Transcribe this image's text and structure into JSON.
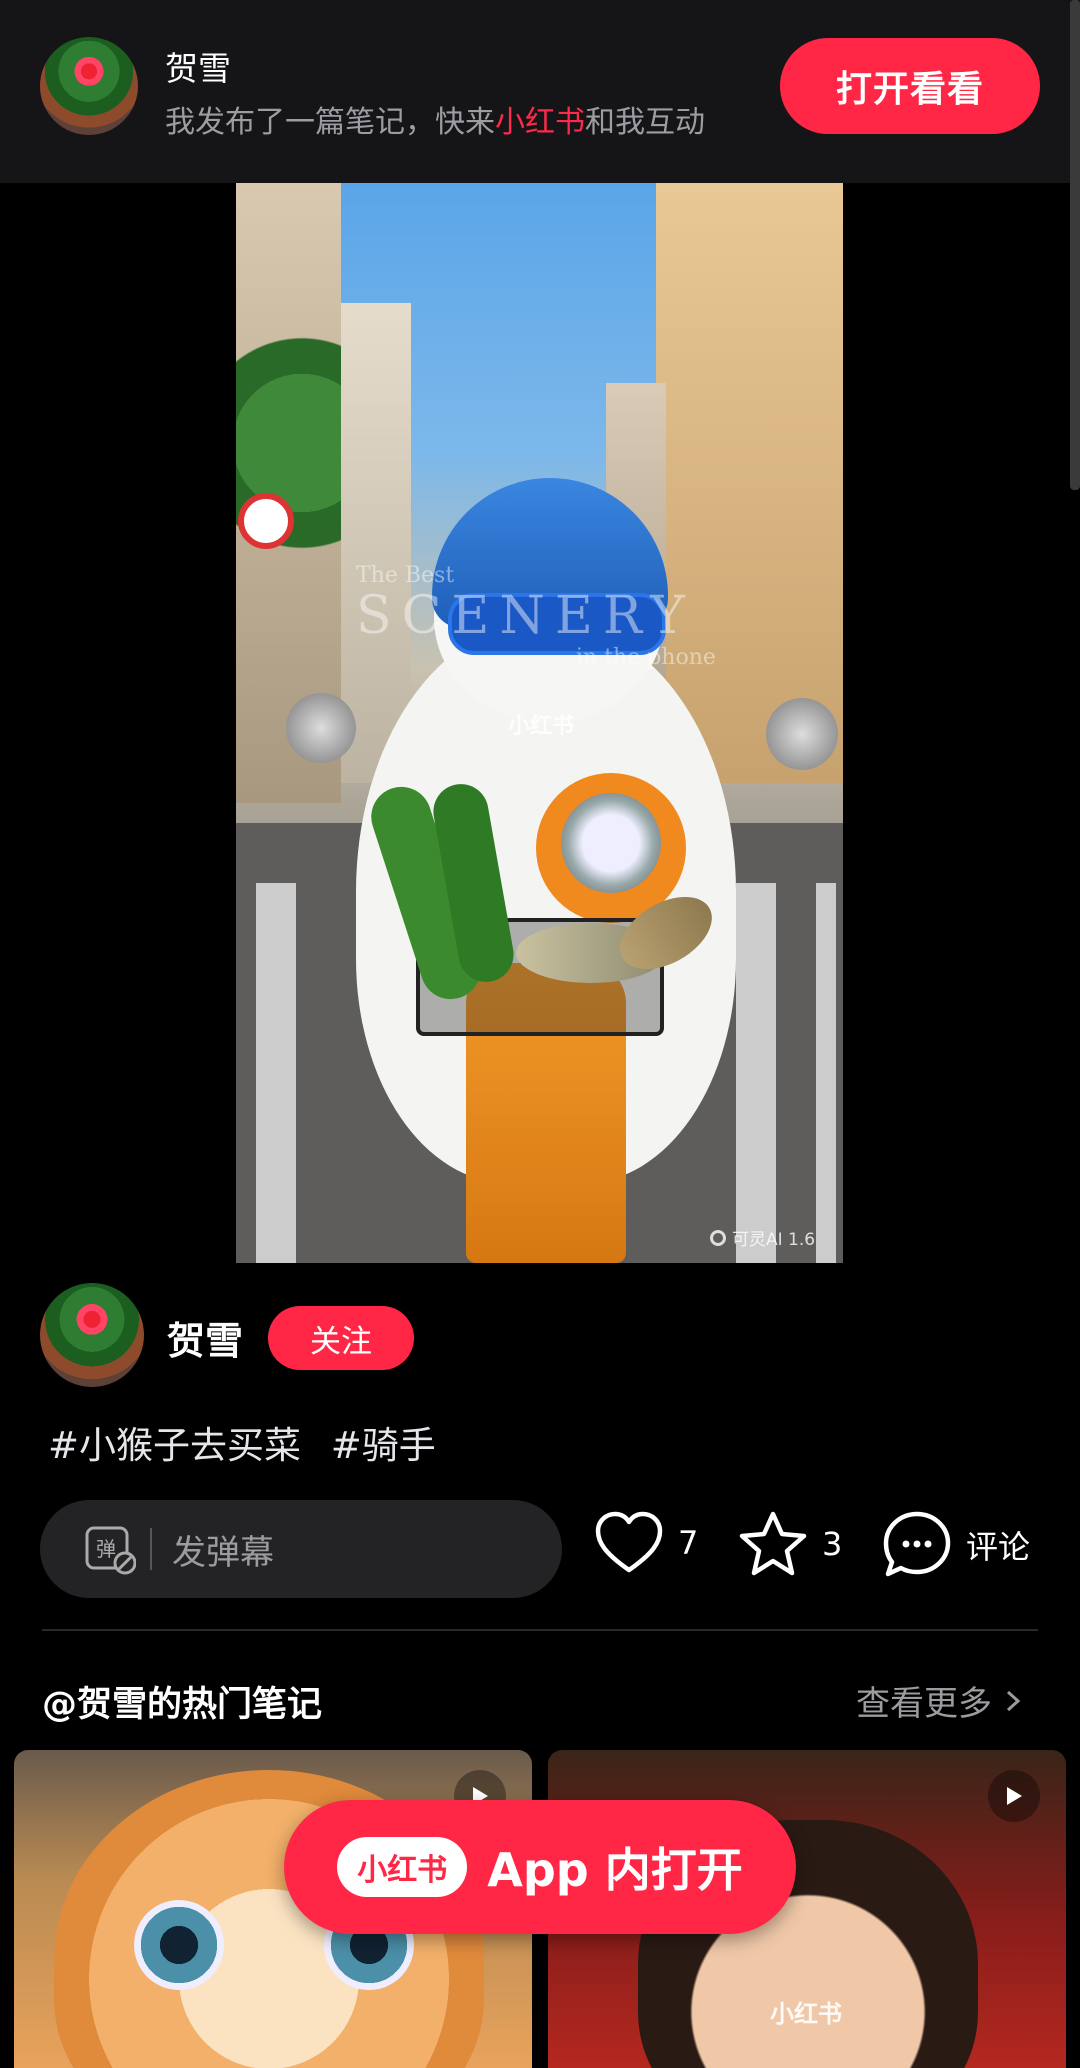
{
  "banner": {
    "author_name": "贺雪",
    "subtitle_pre": "我发布了一篇笔记，快来",
    "subtitle_brand": "小红书",
    "subtitle_post": "和我互动",
    "open_button": "打开看看"
  },
  "video": {
    "logo_text": "小红书",
    "watermark_line1": "The Best",
    "watermark_line2": "SCENERY",
    "watermark_line3": "in the phone",
    "ai_badge": "可灵AI 1.6"
  },
  "author": {
    "name": "贺雪",
    "follow_label": "关注"
  },
  "tags": [
    "#小猴子去买菜",
    "#骑手"
  ],
  "interaction": {
    "danmaku_icon_char": "弹",
    "danmaku_placeholder": "发弹幕",
    "like_count": "7",
    "fav_count": "3",
    "comment_label": "评论"
  },
  "hot_notes": {
    "title": "@贺雪的热门笔记",
    "see_more": "查看更多",
    "thumb2_logo": "小红书"
  },
  "app_open": {
    "logo_text": "小红书",
    "label": "App 内打开"
  },
  "colors": {
    "accent": "#ff2745",
    "banner_bg": "#151518"
  }
}
